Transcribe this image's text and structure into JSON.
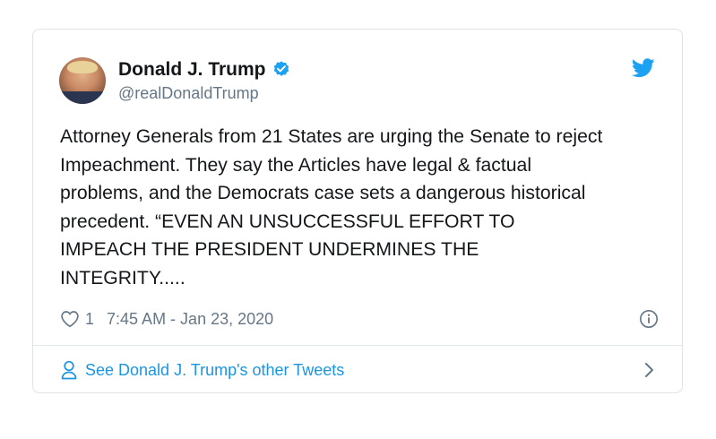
{
  "user": {
    "display_name": "Donald J. Trump",
    "handle": "@realDonaldTrump",
    "verified": true
  },
  "tweet": {
    "text": "Attorney Generals from 21 States are urging the Senate to reject\nImpeachment. They say the Articles have legal & factual\nproblems, and the Democrats case sets a dangerous historical\nprecedent. “EVEN AN UNSUCCESSFUL EFFORT TO\nIMPEACH THE PRESIDENT UNDERMINES THE\nINTEGRITY....."
  },
  "meta": {
    "likes": "1",
    "timestamp": "7:45 AM - Jan 23, 2020"
  },
  "footer": {
    "link_label": "See Donald J. Trump's other Tweets"
  },
  "colors": {
    "accent": "#1da1f2",
    "link": "#1b95e0",
    "secondary_text": "#657786",
    "border": "#dfe3e8"
  },
  "icons": {
    "verified": "verified-badge-icon",
    "brand": "twitter-bird-icon",
    "like": "heart-icon",
    "info": "info-icon",
    "profile": "person-icon",
    "next": "chevron-right-icon"
  }
}
